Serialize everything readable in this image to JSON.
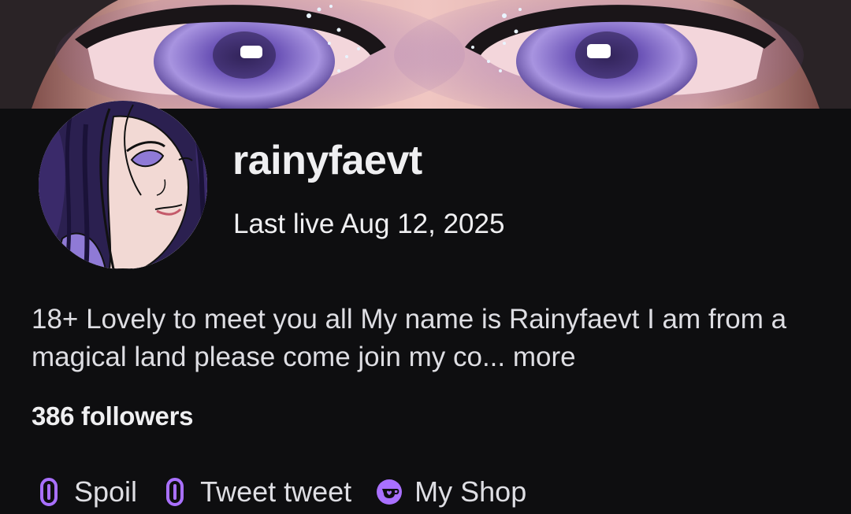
{
  "profile": {
    "username": "rainyfaevt",
    "last_live": "Last live Aug 12, 2025",
    "bio_text": "18+ Lovely to meet you all My name is Rainyfaevt I am from a magical land please come join my co...",
    "bio_more": "more",
    "followers": "386 followers"
  },
  "links": [
    {
      "label": "Spoil",
      "icon": "link-icon"
    },
    {
      "label": "Tweet tweet",
      "icon": "link-icon"
    },
    {
      "label": "My Shop",
      "icon": "shop-icon"
    }
  ],
  "colors": {
    "background": "#0e0e10",
    "text": "#efeff1",
    "accent": "#a970ff"
  }
}
